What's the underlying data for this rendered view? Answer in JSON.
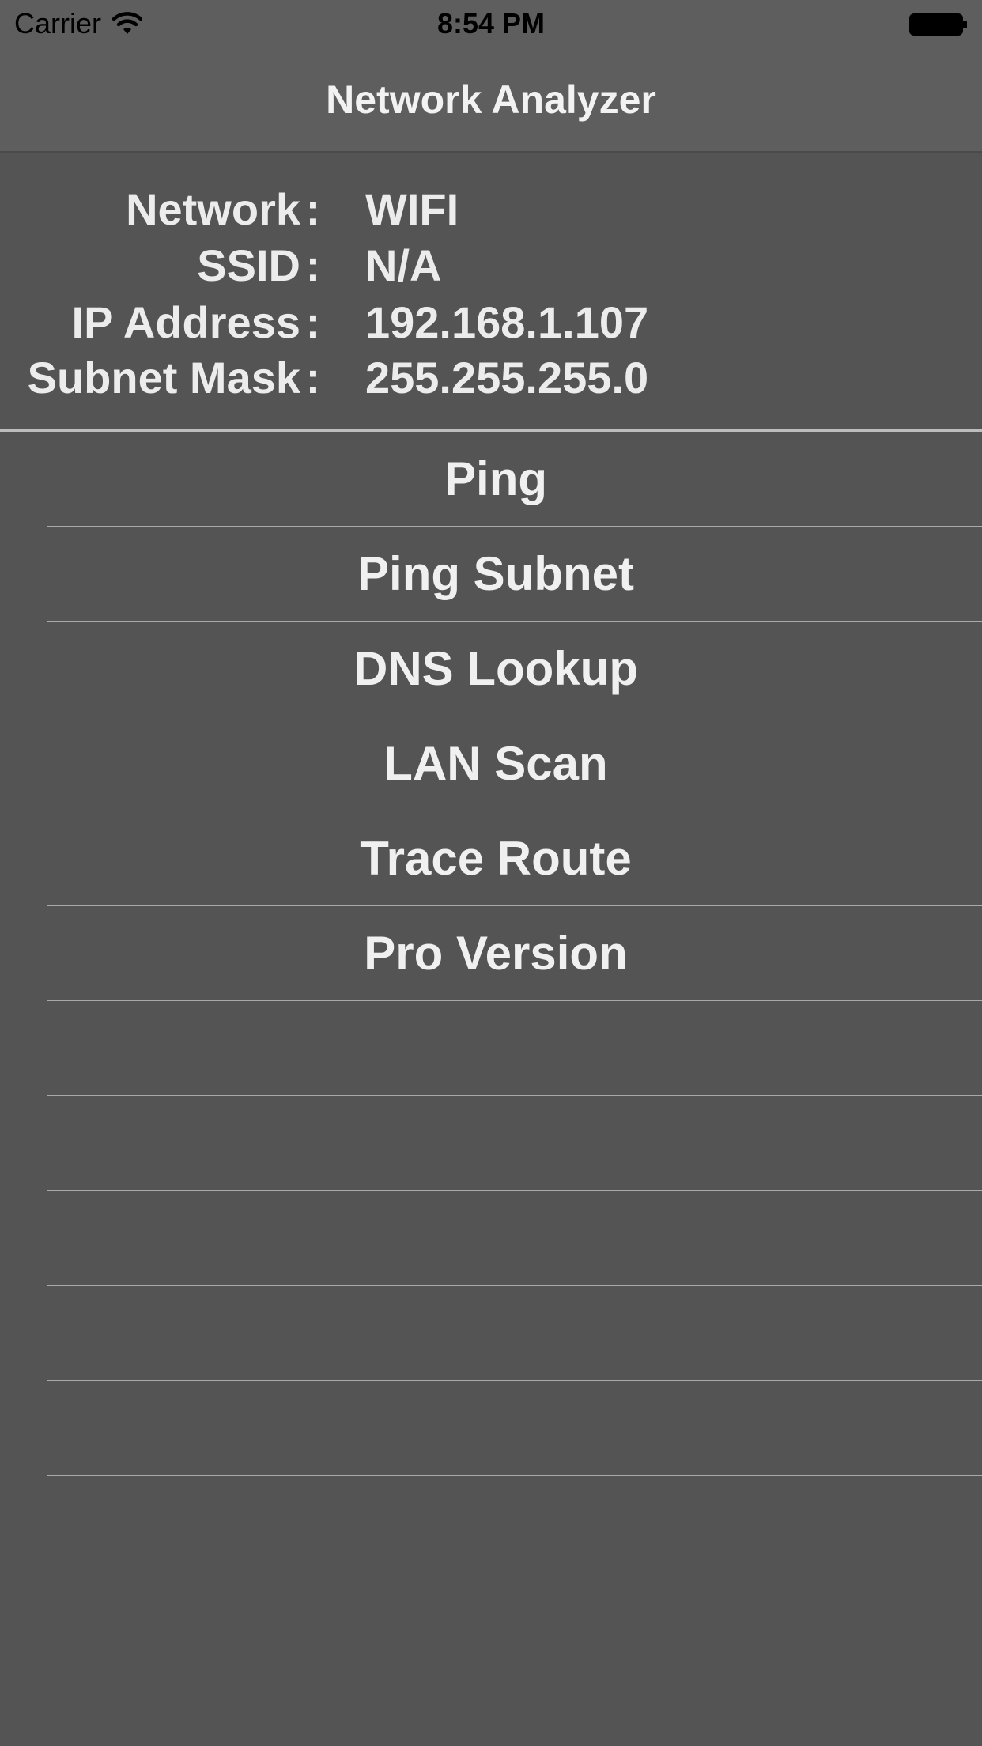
{
  "status_bar": {
    "carrier": "Carrier",
    "time": "8:54 PM"
  },
  "nav": {
    "title": "Network Analyzer"
  },
  "info": {
    "rows": [
      {
        "label": "Network",
        "colon": ":",
        "value": "WIFI"
      },
      {
        "label": "SSID",
        "colon": ":",
        "value": "N/A"
      },
      {
        "label": "IP Address",
        "colon": ":",
        "value": "192.168.1.107"
      },
      {
        "label": "Subnet Mask",
        "colon": ":",
        "value": "255.255.255.0"
      }
    ]
  },
  "menu": {
    "items": [
      {
        "label": "Ping"
      },
      {
        "label": "Ping Subnet"
      },
      {
        "label": "DNS Lookup"
      },
      {
        "label": "LAN Scan"
      },
      {
        "label": "Trace Route"
      },
      {
        "label": "Pro Version"
      },
      {
        "label": ""
      },
      {
        "label": ""
      },
      {
        "label": ""
      },
      {
        "label": ""
      },
      {
        "label": ""
      },
      {
        "label": ""
      },
      {
        "label": ""
      }
    ]
  },
  "colors": {
    "background": "#545454",
    "nav_background": "#5e5e5e",
    "text": "#ececec",
    "separator": "#a9a9a9"
  },
  "icons": {
    "wifi": "wifi-icon",
    "battery": "battery-icon"
  }
}
